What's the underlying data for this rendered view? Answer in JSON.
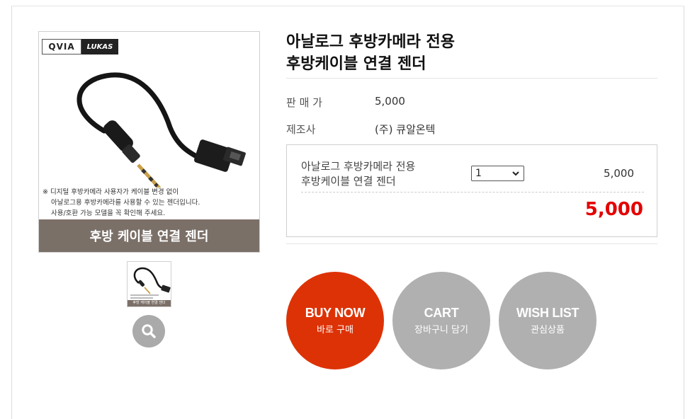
{
  "image": {
    "logo_qvia": "QVIA",
    "logo_lukas": "LUKAS",
    "notes": [
      "※ 디지털 후방카메라 사용자가 케이블 변경 없이",
      "아날로그용 후방카메라를 사용할 수 있는 젠더입니다.",
      "사용/호환 가능 모델을 꼭 확인해 주세요."
    ],
    "banner": "후방 케이블 연결 젠더"
  },
  "thumbnail": {
    "banner": "후방 케이블 연결 젠더"
  },
  "product": {
    "title_line1": "아날로그 후방카메라 전용",
    "title_line2": "후방케이블 연결 젠더",
    "price_label": "판 매 가",
    "price_value": "5,000",
    "maker_label": "제조사",
    "maker_value": "(주) 큐알온텍"
  },
  "option": {
    "name_line1": "아날로그 후방카메라 전용",
    "name_line2": "후방케이블 연결 젠더",
    "quantity": "1",
    "price": "5,000",
    "total": "5,000"
  },
  "buttons": {
    "buy_en": "BUY NOW",
    "buy_ko": "바로 구매",
    "cart_en": "CART",
    "cart_ko": "장바구니 담기",
    "wish_en": "WISH LIST",
    "wish_ko": "관심상품"
  },
  "colors": {
    "buy": "#dd3206",
    "secondary": "#b0b0b0",
    "total": "#e30000",
    "banner": "#7b7068"
  }
}
